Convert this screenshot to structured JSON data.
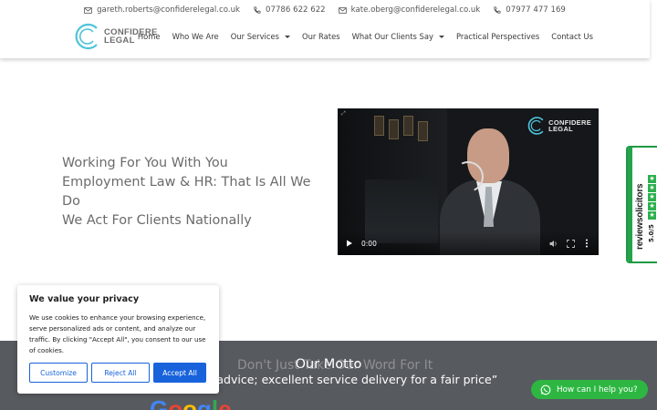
{
  "header": {
    "contacts": [
      {
        "icon": "envelope-icon",
        "text": "gareth.roberts@confiderelegal.co.uk"
      },
      {
        "icon": "phone-icon",
        "text": "07786 622 622"
      },
      {
        "icon": "envelope-icon",
        "text": "kate.oberg@confiderelegal.co.uk"
      },
      {
        "icon": "phone-icon",
        "text": "07977 477 169"
      }
    ],
    "logo": {
      "line1": "CONFIDERE",
      "line2": "LEGAL"
    },
    "nav": [
      {
        "label": "Home",
        "dropdown": false
      },
      {
        "label": "Who We Are",
        "dropdown": false
      },
      {
        "label": "Our Services",
        "dropdown": true
      },
      {
        "label": "Our Rates",
        "dropdown": false
      },
      {
        "label": "What Our Clients Say",
        "dropdown": true
      },
      {
        "label": "Practical Perspectives",
        "dropdown": false
      },
      {
        "label": "Contact Us",
        "dropdown": false
      }
    ]
  },
  "hero": {
    "lines": [
      "Working For You With You",
      "Employment Law & HR: That Is All We Do",
      "We Act For Clients Nationally"
    ]
  },
  "video": {
    "time": "0:00",
    "logo_line1": "CONFIDERE",
    "logo_line2": "LEGAL"
  },
  "review_badge": {
    "brand": "reviewsolicitors",
    "score": "5.0",
    "score_suffix": "/5",
    "stars": 5
  },
  "motto": {
    "ghost_text": "Don't Just Take Our Word For It",
    "title": "Our Motto",
    "quote": "y advice; excellent service delivery for a fair price”"
  },
  "cookie": {
    "title": "We value your privacy",
    "text": "We use cookies to enhance your browsing experience, serve personalized ads or content, and analyze our traffic. By clicking \"Accept All\", you consent to our use of cookies.",
    "customize": "Customize",
    "reject": "Reject All",
    "accept": "Accept All"
  },
  "whatsapp": {
    "label": "How can I help you?"
  },
  "colors": {
    "brand_cyan": "#4fc3d9",
    "cookie_blue": "#1863dc",
    "whatsapp_green": "#2db742",
    "motto_band": "#575a5f"
  }
}
